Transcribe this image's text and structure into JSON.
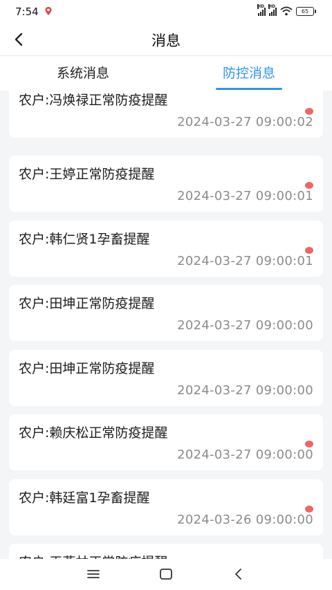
{
  "status_bar": {
    "time": "7:54",
    "signal_label": "HD",
    "battery": "65"
  },
  "header": {
    "title": "消息"
  },
  "tabs": [
    {
      "label": "系统消息",
      "active": false
    },
    {
      "label": "防控消息",
      "active": true
    }
  ],
  "colors": {
    "accent": "#2f95e9",
    "unread": "#f06464"
  },
  "messages": [
    {
      "title": "农户:冯焕禄正常防疫提醒",
      "time": "2024-03-27 09:00:02",
      "unread": true
    },
    {
      "title": "农户:王婷正常防疫提醒",
      "time": "2024-03-27 09:00:01",
      "unread": true
    },
    {
      "title": "农户:韩仁贤1孕畜提醒",
      "time": "2024-03-27 09:00:01",
      "unread": true
    },
    {
      "title": "农户:田坤正常防疫提醒",
      "time": "2024-03-27 09:00:00",
      "unread": false
    },
    {
      "title": "农户:田坤正常防疫提醒",
      "time": "2024-03-27 09:00:00",
      "unread": false
    },
    {
      "title": "农户:赖庆松正常防疫提醒",
      "time": "2024-03-27 09:00:00",
      "unread": true
    },
    {
      "title": "农户:韩廷富1孕畜提醒",
      "time": "2024-03-26 09:00:00",
      "unread": true
    },
    {
      "title": "农户:王燕林正常防疫提醒",
      "time": "",
      "unread": false
    }
  ],
  "nav": {
    "icons": [
      "menu-icon",
      "home-icon",
      "back-icon"
    ]
  }
}
